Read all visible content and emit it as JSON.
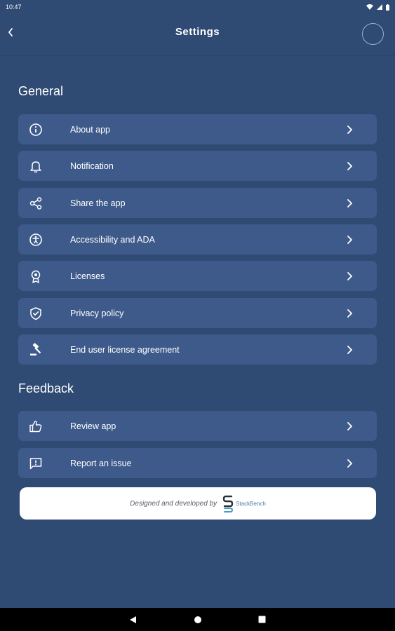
{
  "status_bar": {
    "time": "10:47"
  },
  "header": {
    "title": "Settings"
  },
  "sections": {
    "general": {
      "title": "General",
      "items": [
        {
          "label": "About app",
          "icon": "info-icon"
        },
        {
          "label": "Notification",
          "icon": "bell-icon"
        },
        {
          "label": "Share the app",
          "icon": "share-icon"
        },
        {
          "label": "Accessibility and ADA",
          "icon": "accessibility-icon"
        },
        {
          "label": "Licenses",
          "icon": "badge-icon"
        },
        {
          "label": "Privacy policy",
          "icon": "shield-check-icon"
        },
        {
          "label": "End user license agreement",
          "icon": "gavel-icon"
        }
      ]
    },
    "feedback": {
      "title": "Feedback",
      "items": [
        {
          "label": "Review app",
          "icon": "thumbs-up-icon"
        },
        {
          "label": "Report an issue",
          "icon": "feedback-icon"
        }
      ]
    }
  },
  "footer": {
    "credit_text": "Designed and developed by",
    "brand_name": "StackBench"
  },
  "colors": {
    "background": "#2f4a73",
    "row_background": "#3d5a8a",
    "brand": "#4a7fa8"
  }
}
